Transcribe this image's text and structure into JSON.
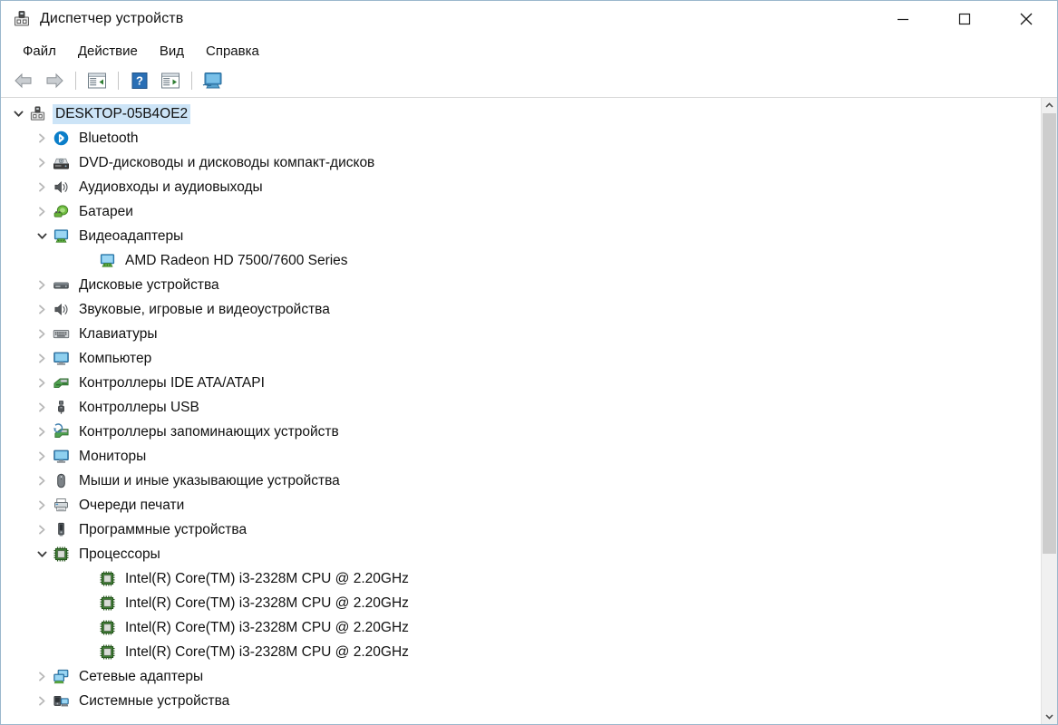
{
  "window": {
    "title": "Диспетчер устройств",
    "title_icon": "device-manager-icon",
    "controls": {
      "minimize": "—",
      "maximize": "□",
      "close": "✕"
    }
  },
  "menubar": {
    "items": [
      {
        "label": "Файл",
        "name": "menu-file"
      },
      {
        "label": "Действие",
        "name": "menu-action"
      },
      {
        "label": "Вид",
        "name": "menu-view"
      },
      {
        "label": "Справка",
        "name": "menu-help"
      }
    ]
  },
  "toolbar": {
    "buttons": [
      {
        "name": "back-button",
        "icon": "arrow-left-icon"
      },
      {
        "name": "forward-button",
        "icon": "arrow-right-icon"
      },
      {
        "name": "separator-1",
        "icon": "separator"
      },
      {
        "name": "properties-button",
        "icon": "properties-window-icon"
      },
      {
        "name": "separator-2",
        "icon": "separator"
      },
      {
        "name": "help-button",
        "icon": "help-question-icon"
      },
      {
        "name": "scan-hardware-button",
        "icon": "scan-window-icon"
      },
      {
        "name": "separator-3",
        "icon": "separator"
      },
      {
        "name": "scan-for-hardware-changes-button",
        "icon": "monitor-scan-icon"
      }
    ]
  },
  "tree": {
    "nodes": [
      {
        "label": "DESKTOP-05B4OE2",
        "level": 0,
        "state": "expanded",
        "icon": "computer-node-icon",
        "selected": true
      },
      {
        "label": "Bluetooth",
        "level": 1,
        "state": "collapsed",
        "icon": "bluetooth-icon",
        "selected": false
      },
      {
        "label": "DVD-дисководы и дисководы компакт-дисков",
        "level": 1,
        "state": "collapsed",
        "icon": "dvd-drive-icon",
        "selected": false
      },
      {
        "label": "Аудиовходы и аудиовыходы",
        "level": 1,
        "state": "collapsed",
        "icon": "speaker-icon",
        "selected": false
      },
      {
        "label": "Батареи",
        "level": 1,
        "state": "collapsed",
        "icon": "battery-icon",
        "selected": false
      },
      {
        "label": "Видеоадаптеры",
        "level": 1,
        "state": "expanded",
        "icon": "display-adapter-icon",
        "selected": false
      },
      {
        "label": "AMD Radeon HD 7500/7600 Series",
        "level": 2,
        "state": "leaf",
        "icon": "display-adapter-icon",
        "selected": false
      },
      {
        "label": "Дисковые устройства",
        "level": 1,
        "state": "collapsed",
        "icon": "disk-drive-icon",
        "selected": false
      },
      {
        "label": "Звуковые, игровые и видеоустройства",
        "level": 1,
        "state": "collapsed",
        "icon": "speaker-icon",
        "selected": false
      },
      {
        "label": "Клавиатуры",
        "level": 1,
        "state": "collapsed",
        "icon": "keyboard-icon",
        "selected": false
      },
      {
        "label": "Компьютер",
        "level": 1,
        "state": "collapsed",
        "icon": "monitor-icon",
        "selected": false
      },
      {
        "label": "Контроллеры IDE ATA/ATAPI",
        "level": 1,
        "state": "collapsed",
        "icon": "ide-controller-icon",
        "selected": false
      },
      {
        "label": "Контроллеры USB",
        "level": 1,
        "state": "collapsed",
        "icon": "usb-icon",
        "selected": false
      },
      {
        "label": "Контроллеры запоминающих устройств",
        "level": 1,
        "state": "collapsed",
        "icon": "storage-controller-icon",
        "selected": false
      },
      {
        "label": "Мониторы",
        "level": 1,
        "state": "collapsed",
        "icon": "monitor-icon",
        "selected": false
      },
      {
        "label": "Мыши и иные указывающие устройства",
        "level": 1,
        "state": "collapsed",
        "icon": "mouse-icon",
        "selected": false
      },
      {
        "label": "Очереди печати",
        "level": 1,
        "state": "collapsed",
        "icon": "printer-icon",
        "selected": false
      },
      {
        "label": "Программные устройства",
        "level": 1,
        "state": "collapsed",
        "icon": "software-device-icon",
        "selected": false
      },
      {
        "label": "Процессоры",
        "level": 1,
        "state": "expanded",
        "icon": "cpu-icon",
        "selected": false
      },
      {
        "label": "Intel(R) Core(TM) i3-2328M CPU @ 2.20GHz",
        "level": 2,
        "state": "leaf",
        "icon": "cpu-icon",
        "selected": false
      },
      {
        "label": "Intel(R) Core(TM) i3-2328M CPU @ 2.20GHz",
        "level": 2,
        "state": "leaf",
        "icon": "cpu-icon",
        "selected": false
      },
      {
        "label": "Intel(R) Core(TM) i3-2328M CPU @ 2.20GHz",
        "level": 2,
        "state": "leaf",
        "icon": "cpu-icon",
        "selected": false
      },
      {
        "label": "Intel(R) Core(TM) i3-2328M CPU @ 2.20GHz",
        "level": 2,
        "state": "leaf",
        "icon": "cpu-icon",
        "selected": false
      },
      {
        "label": "Сетевые адаптеры",
        "level": 1,
        "state": "collapsed",
        "icon": "network-adapter-icon",
        "selected": false
      },
      {
        "label": "Системные устройства",
        "level": 1,
        "state": "collapsed",
        "icon": "system-device-icon",
        "selected": false
      }
    ]
  },
  "scrollbar": {
    "up_arrow": "∧",
    "down_arrow": "∨"
  },
  "colors": {
    "selection": "#cce4f7",
    "window_border": "#9bb7cc",
    "chevron_collapsed": "#b8b8b8",
    "chevron_expanded": "#3b3b3b",
    "text": "#111111"
  }
}
